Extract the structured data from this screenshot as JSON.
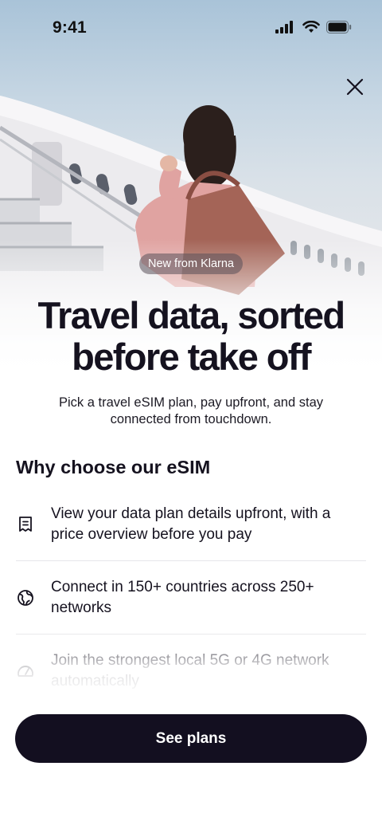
{
  "status_bar": {
    "time": "9:41",
    "icons": [
      "cellular-signal-icon",
      "wifi-icon",
      "battery-icon"
    ]
  },
  "hero": {
    "close_icon": "close-icon",
    "badge": "New from Klarna",
    "headline_line1": "Travel data, sorted",
    "headline_line2": "before take off",
    "subtext": "Pick a travel eSIM plan, pay upfront, and stay connected from touchdown."
  },
  "why": {
    "title": "Why choose our eSIM",
    "features": [
      {
        "icon": "receipt-icon",
        "text": "View your data plan details upfront, with a price overview before you pay"
      },
      {
        "icon": "globe-icon",
        "text": "Connect in 150+ countries across 250+ networks"
      },
      {
        "icon": "speedometer-icon",
        "text": "Join the strongest local 5G or 4G network automatically"
      }
    ]
  },
  "cta": {
    "label": "See plans"
  },
  "colors": {
    "text_primary": "#15121f",
    "cta_background": "#130f20",
    "cta_text": "#ffffff",
    "divider": "#e6e6ea"
  }
}
